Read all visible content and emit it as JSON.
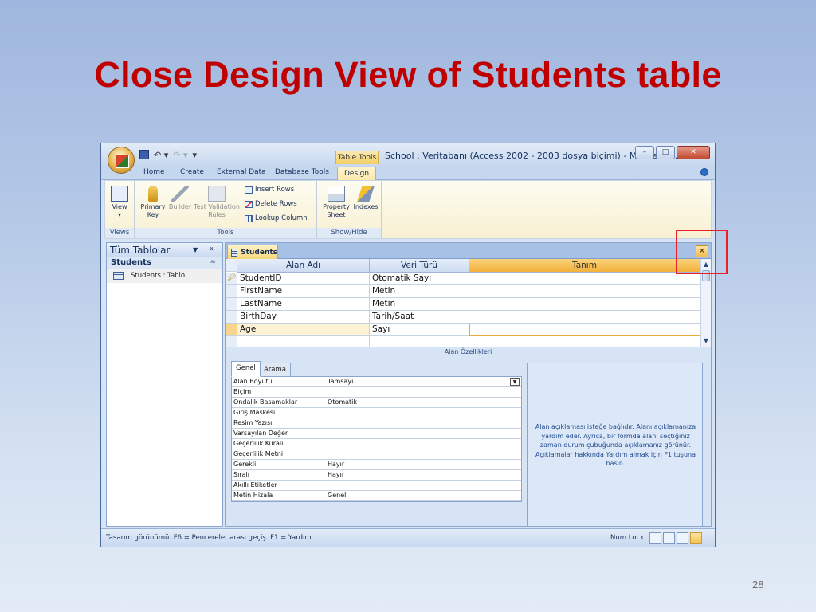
{
  "slide": {
    "title": "Close Design View of Students table",
    "page_number": "28"
  },
  "window": {
    "title": "School : Veritabanı (Access 2002 - 2003 dosya biçimi) - Microsoft ...",
    "context_tab_group": "Table Tools",
    "controls": {
      "minimize": "–",
      "maximize": "□",
      "close": "✕"
    }
  },
  "ribbon_tabs": [
    {
      "label": "Home"
    },
    {
      "label": "Create"
    },
    {
      "label": "External Data"
    },
    {
      "label": "Database Tools"
    },
    {
      "label": "Design",
      "active": true
    }
  ],
  "ribbon": {
    "groups": {
      "views": "Views",
      "tools": "Tools",
      "show_hide": "Show/Hide"
    },
    "buttons": {
      "view": "View",
      "view_arrow": "▾",
      "primary_key": "Primary Key",
      "builder": "Builder",
      "test_validation_rules": "Test Validation Rules",
      "insert_rows": "Insert Rows",
      "delete_rows": "Delete Rows",
      "lookup_column": "Lookup Column",
      "property_sheet": "Property Sheet",
      "indexes": "Indexes"
    }
  },
  "nav_pane": {
    "header": "Tüm Tablolar",
    "group": "Students",
    "items": [
      {
        "label": "Students : Tablo"
      }
    ]
  },
  "document": {
    "tab_label": "Students",
    "close_glyph": "✕",
    "columns": [
      "Alan Adı",
      "Veri Türü",
      "Tanım"
    ],
    "rows": [
      {
        "field": "StudentID",
        "type": "Otomatik Sayı",
        "desc": "",
        "primary_key": true
      },
      {
        "field": "FirstName",
        "type": "Metin",
        "desc": ""
      },
      {
        "field": "LastName",
        "type": "Metin",
        "desc": ""
      },
      {
        "field": "BirthDay",
        "type": "Tarih/Saat",
        "desc": ""
      },
      {
        "field": "Age",
        "type": "Sayı",
        "desc": "",
        "current": true
      }
    ],
    "properties_bar": "Alan Özellikleri"
  },
  "properties": {
    "tabs": [
      "Genel",
      "Arama"
    ],
    "rows": [
      {
        "key": "Alan Boyutu",
        "value": "Tamsayı"
      },
      {
        "key": "Biçim",
        "value": ""
      },
      {
        "key": "Ondalık Basamaklar",
        "value": "Otomatik"
      },
      {
        "key": "Giriş Maskesi",
        "value": ""
      },
      {
        "key": "Resim Yazısı",
        "value": ""
      },
      {
        "key": "Varsayılan Değer",
        "value": ""
      },
      {
        "key": "Geçerlilik Kuralı",
        "value": ""
      },
      {
        "key": "Geçerlilik Metni",
        "value": ""
      },
      {
        "key": "Gerekli",
        "value": "Hayır"
      },
      {
        "key": "Sıralı",
        "value": "Hayır"
      },
      {
        "key": "Akıllı Etiketler",
        "value": ""
      },
      {
        "key": "Metin Hizala",
        "value": "Genel"
      }
    ],
    "help_text": "Alan açıklaması isteğe bağlıdır. Alanı açıklamanıza yardım eder. Ayrıca, bir formda alanı seçtiğiniz zaman durum çubuğunda açıklamanız görünür. Açıklamalar hakkında Yardım almak için F1 tuşuna basın."
  },
  "statusbar": {
    "left": "Tasarım görünümü.  F6 = Pencereler arası geçiş.  F1 = Yardım.",
    "num_lock": "Num Lock"
  }
}
